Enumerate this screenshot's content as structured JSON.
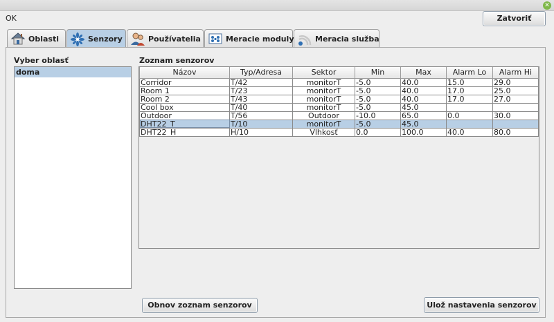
{
  "window": {
    "status_text": "OK",
    "close_glyph": "✕"
  },
  "header": {
    "close_button_label": "Zatvoriť"
  },
  "tabs": [
    {
      "label": "Oblasti",
      "icon": "house-icon",
      "active": false
    },
    {
      "label": "Senzory",
      "icon": "sensor-burst-icon",
      "active": true
    },
    {
      "label": "Používatelia",
      "icon": "users-icon",
      "active": false
    },
    {
      "label": "Meracie moduly",
      "icon": "module-icon",
      "active": false
    },
    {
      "label": "Meracia služba",
      "icon": "wifi-service-icon",
      "active": false
    }
  ],
  "areas": {
    "label": "Vyber oblasť",
    "items": [
      {
        "label": "doma",
        "selected": true
      }
    ]
  },
  "sensors": {
    "label": "Zoznam senzorov",
    "columns": [
      "Názov",
      "Typ/Adresa",
      "Sektor",
      "Min",
      "Max",
      "Alarm Lo",
      "Alarm Hi"
    ],
    "rows": [
      [
        "Corridor",
        "T/42",
        "monitorT",
        "-5.0",
        "40.0",
        "15.0",
        "29.0"
      ],
      [
        "Room 1",
        "T/23",
        "monitorT",
        "-5.0",
        "40.0",
        "17.0",
        "25.0"
      ],
      [
        "Room 2",
        "T/43",
        "monitorT",
        "-5.0",
        "40.0",
        "17.0",
        "27.0"
      ],
      [
        "Cool box",
        "T/40",
        "monitorT",
        "-5.0",
        "45.0",
        "",
        ""
      ],
      [
        "Outdoor",
        "T/56",
        "Outdoor",
        "-10.0",
        "65.0",
        "0.0",
        "30.0"
      ],
      [
        "DHT22_T",
        "T/10",
        "monitorT",
        "-5.0",
        "45.0",
        "",
        ""
      ],
      [
        "DHT22_H",
        "H/10",
        "Vlhkosť",
        "0.0",
        "100.0",
        "40.0",
        "80.0"
      ]
    ],
    "selected_row": 5
  },
  "buttons": {
    "reload_label": "Obnov zoznam senzorov",
    "save_label": "Ulož nastavenia senzorov"
  },
  "colors": {
    "selection": "#b8cfe5",
    "accent": "#2f6fb3"
  }
}
